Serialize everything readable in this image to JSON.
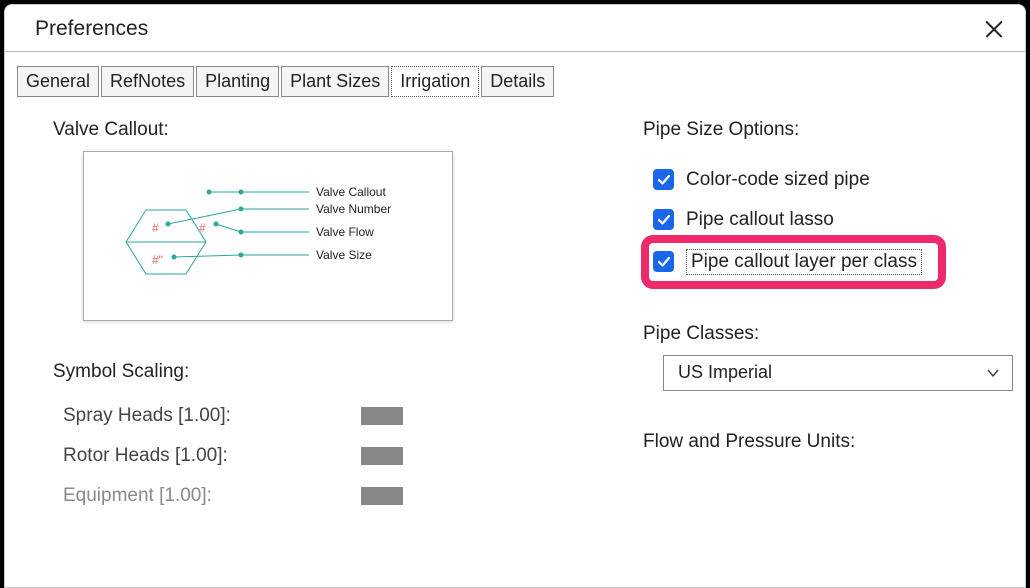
{
  "window": {
    "title": "Preferences"
  },
  "tabs": {
    "items": [
      "General",
      "RefNotes",
      "Planting",
      "Plant Sizes",
      "Irrigation",
      "Details"
    ],
    "active_index": 4
  },
  "left": {
    "valve_callout_label": "Valve Callout:",
    "preview": {
      "callout": "Valve Callout",
      "number": "Valve Number",
      "flow": "Valve Flow",
      "size": "Valve Size",
      "hash1": "#",
      "hash2": "#",
      "hash3": "#\""
    },
    "symbol_scaling_label": "Symbol Scaling:",
    "scaling": [
      {
        "label": "Spray Heads [1.00]:"
      },
      {
        "label": "Rotor Heads [1.00]:"
      },
      {
        "label": "Equipment [1.00]:",
        "dim": true
      }
    ]
  },
  "right": {
    "pipe_size_options_label": "Pipe Size Options:",
    "checks": [
      {
        "label": "Color-code sized pipe",
        "checked": true
      },
      {
        "label": "Pipe callout lasso",
        "checked": true
      },
      {
        "label": "Pipe callout layer per class",
        "checked": true,
        "highlighted": true
      }
    ],
    "pipe_classes_label": "Pipe Classes:",
    "pipe_classes_value": "US Imperial",
    "flow_pressure_label": "Flow and Pressure Units:"
  }
}
